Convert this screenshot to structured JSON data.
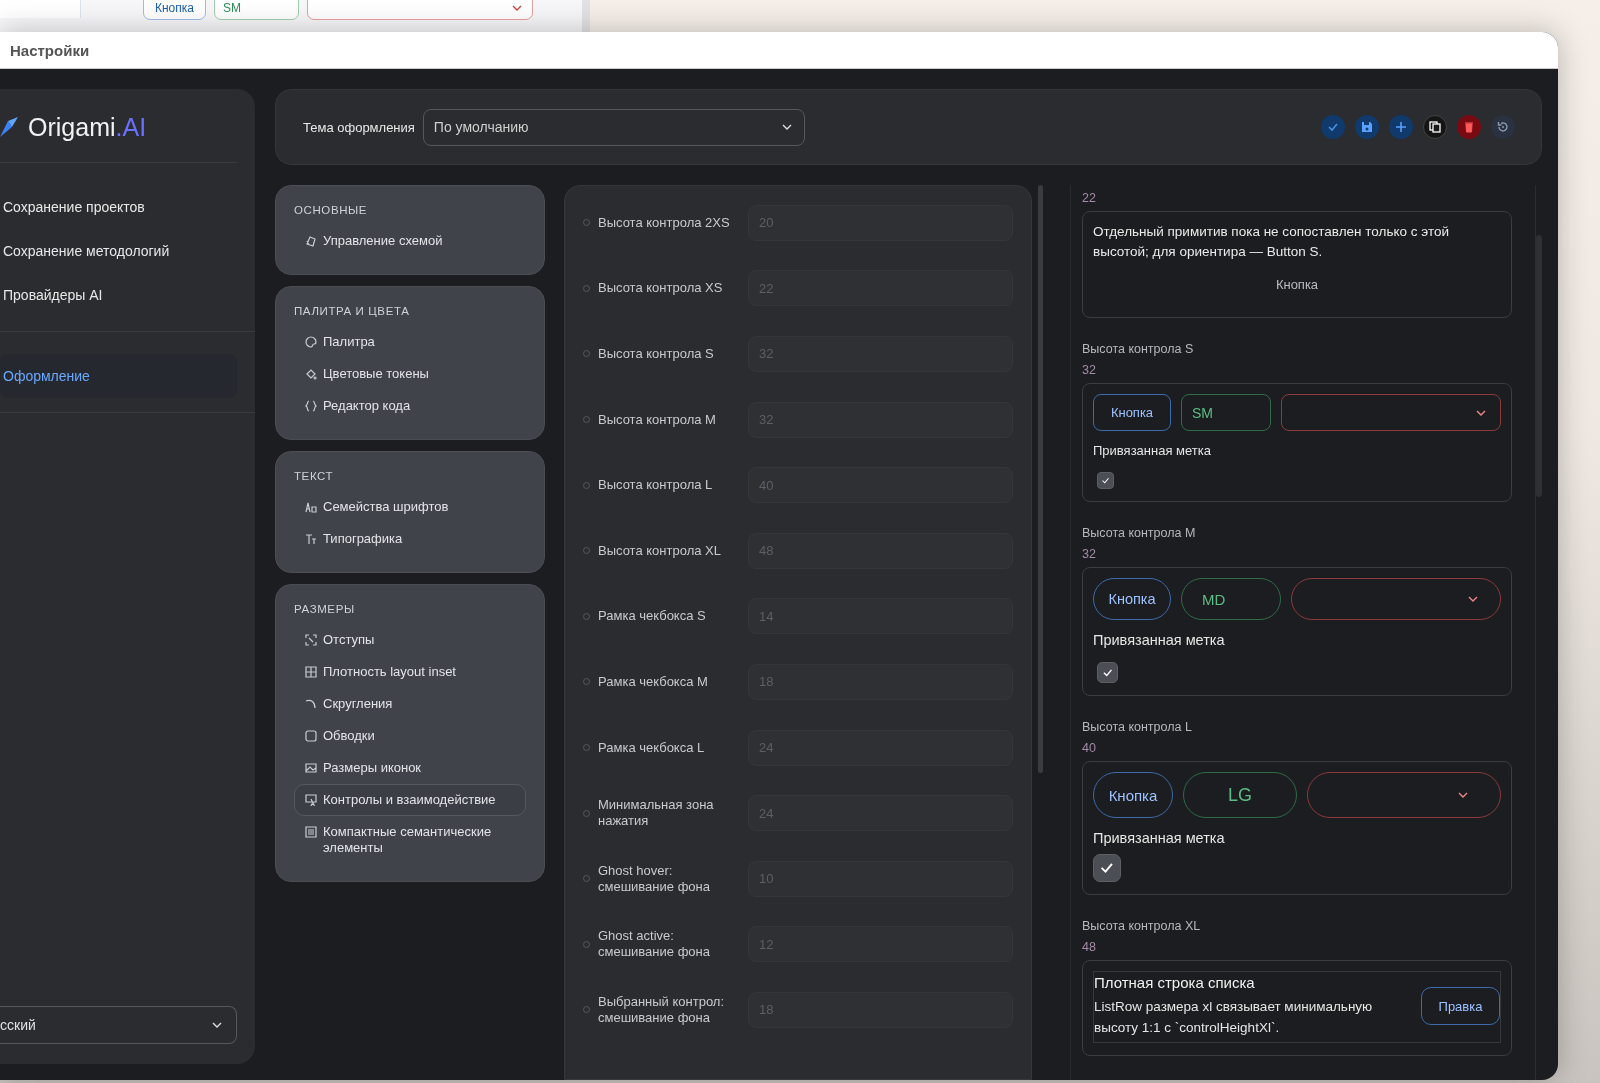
{
  "background_window": {
    "controls": [
      {
        "kind": "button",
        "label": "Кнопка"
      },
      {
        "kind": "size",
        "label": "SM"
      },
      {
        "kind": "select"
      }
    ]
  },
  "window": {
    "title": "Настройки"
  },
  "sidebar": {
    "logo": {
      "text": "Origami",
      "accent": ".AI"
    },
    "sections": [
      {
        "items": [
          {
            "label": "Сохранение проектов",
            "selected": false
          },
          {
            "label": "Сохранение методологий",
            "selected": false
          },
          {
            "label": "Провайдеры AI",
            "selected": false
          }
        ]
      },
      {
        "items": [
          {
            "label": "Оформление",
            "selected": true
          }
        ]
      }
    ],
    "language_select": {
      "value": "сский"
    }
  },
  "toolbar": {
    "theme_label": "Тема оформления",
    "theme_select": {
      "value": "По умолчанию"
    },
    "actions": [
      {
        "kind": "apply"
      },
      {
        "kind": "save"
      },
      {
        "kind": "add"
      },
      {
        "kind": "copy"
      },
      {
        "kind": "delete"
      },
      {
        "kind": "reset"
      }
    ]
  },
  "nav": {
    "groups": [
      {
        "title": "ОСНОВНЫЕ",
        "items": [
          {
            "label": "Управление схемой",
            "selected": false
          }
        ]
      },
      {
        "title": "ПАЛИТРА И ЦВЕТА",
        "items": [
          {
            "label": "Палитра",
            "selected": false
          },
          {
            "label": "Цветовые токены",
            "selected": false
          },
          {
            "label": "Редактор кода",
            "selected": false
          }
        ]
      },
      {
        "title": "ТЕКСТ",
        "items": [
          {
            "label": "Семейства шрифтов",
            "selected": false
          },
          {
            "label": "Типографика",
            "selected": false
          }
        ]
      },
      {
        "title": "РАЗМЕРЫ",
        "items": [
          {
            "label": "Отступы",
            "selected": false
          },
          {
            "label": "Плотность layout inset",
            "selected": false
          },
          {
            "label": "Скругления",
            "selected": false
          },
          {
            "label": "Обводки",
            "selected": false
          },
          {
            "label": "Размеры иконок",
            "selected": false
          },
          {
            "label": "Контролы и взаимодействие",
            "selected": true
          },
          {
            "label": "Компактные семантические элементы",
            "selected": false
          }
        ]
      }
    ]
  },
  "tokens": {
    "rows": [
      {
        "label": "Высота контрола 2XS",
        "placeholder": "20"
      },
      {
        "label": "Высота контрола XS",
        "placeholder": "22"
      },
      {
        "label": "Высота контрола S",
        "placeholder": "32"
      },
      {
        "label": "Высота контрола M",
        "placeholder": "32"
      },
      {
        "label": "Высота контрола L",
        "placeholder": "40"
      },
      {
        "label": "Высота контрола XL",
        "placeholder": "48"
      },
      {
        "label": "Рамка чекбокса S",
        "placeholder": "14"
      },
      {
        "label": "Рамка чекбокса M",
        "placeholder": "18"
      },
      {
        "label": "Рамка чекбокса L",
        "placeholder": "24"
      },
      {
        "label": "Минимальная зона нажатия",
        "placeholder": "24"
      },
      {
        "label": "Ghost hover: смешивание фона",
        "placeholder": "10"
      },
      {
        "label": "Ghost active: смешивание фона",
        "placeholder": "12"
      },
      {
        "label": "Выбранный контрол: смешивание фона",
        "placeholder": "18"
      }
    ]
  },
  "preview": {
    "sections": [
      {
        "kind": "note",
        "value": "22",
        "text": "Отдельный примитив пока не сопоставлен только с этой высотой; для ориентира — Button S.",
        "button": "Кнопка"
      },
      {
        "kind": "small",
        "title": "Высота контрола S",
        "value": "32",
        "button": "Кнопка",
        "tag": "SM",
        "label": "Привязанная метка",
        "checked": true
      },
      {
        "kind": "medium",
        "title": "Высота контрола M",
        "value": "32",
        "button": "Кнопка",
        "tag": "MD",
        "label": "Привязанная метка",
        "checked": true
      },
      {
        "kind": "large",
        "title": "Высота контрола L",
        "value": "40",
        "button": "Кнопка",
        "tag": "LG",
        "label": "Привязанная метка",
        "checked": true
      },
      {
        "kind": "list_row",
        "title": "Высота контрола XL",
        "value": "48",
        "row_title": "Плотная строка списка",
        "row_text": "ListRow размера xl связывает минимальную высоту 1:1 с `controlHeightXl`.",
        "button": "Правка"
      }
    ]
  }
}
